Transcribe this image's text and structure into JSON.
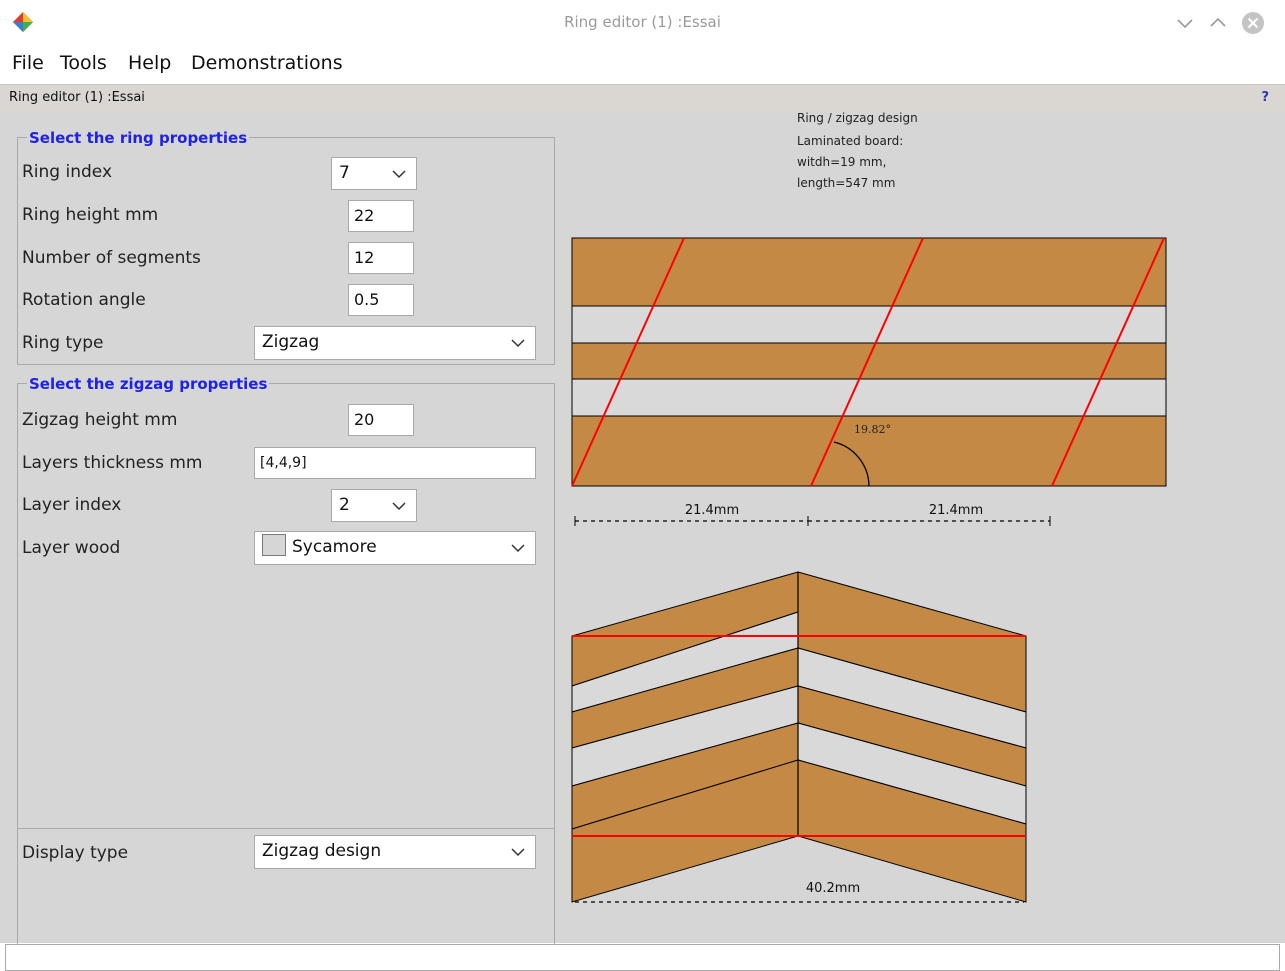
{
  "window": {
    "title": "Ring editor (1) :Essai"
  },
  "menu": {
    "items": [
      "File",
      "Tools",
      "Help",
      "Demonstrations"
    ]
  },
  "subheader": {
    "title": "Ring editor (1) :Essai",
    "help": "?"
  },
  "ring_group": {
    "title": "Select the ring properties",
    "ring_index": {
      "label": "Ring index",
      "value": "7"
    },
    "ring_height": {
      "label": "Ring height mm",
      "value": "22"
    },
    "segments": {
      "label": "Number of segments",
      "value": "12"
    },
    "rotation": {
      "label": "Rotation angle",
      "value": "0.5"
    },
    "ring_type": {
      "label": "Ring type",
      "value": "Zigzag"
    }
  },
  "zigzag_group": {
    "title": "Select the zigzag properties",
    "zigzag_height": {
      "label": "Zigzag height mm",
      "value": "20"
    },
    "layers_thickness": {
      "label": "Layers thickness mm",
      "value": "[4,4,9]"
    },
    "layer_index": {
      "label": "Layer index",
      "value": "2"
    },
    "layer_wood": {
      "label": "Layer wood",
      "value": "Sycamore"
    }
  },
  "display": {
    "label": "Display type",
    "value": "Zigzag design"
  },
  "drawing": {
    "info": [
      "Ring / zigzag design",
      "Laminated board:",
      "witdh=19 mm,",
      "length=547 mm"
    ],
    "angle_label": "19.82°",
    "dim_left": "21.4mm",
    "dim_right": "21.4mm",
    "dim_bottom": "40.2mm",
    "colors": {
      "wood": "#c48a45",
      "light_layer": "#d9d9d9",
      "cut_line": "#ff0000"
    }
  }
}
